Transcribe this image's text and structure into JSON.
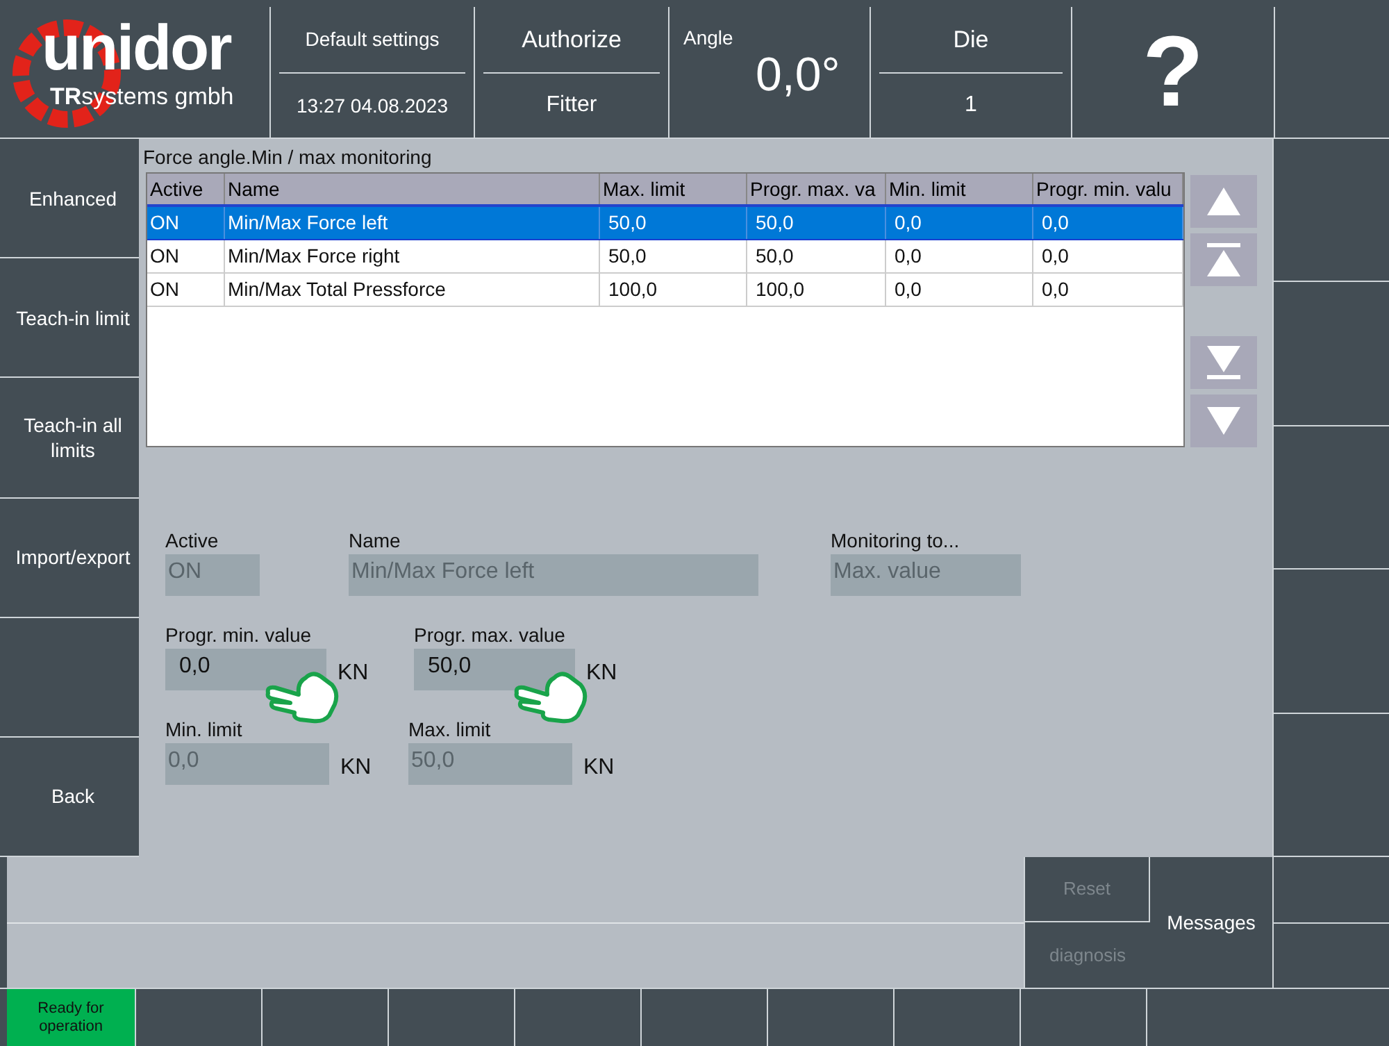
{
  "header": {
    "logo": {
      "brand": "unidor",
      "sub_bold": "TR",
      "sub": "systems gmbh"
    },
    "profile": "Default settings",
    "datetime": "13:27 04.08.2023",
    "authorize_button": "Authorize",
    "user": "Fitter",
    "angle": {
      "label": "Angle",
      "value": "0,0°"
    },
    "die": {
      "label": "Die",
      "value": "1"
    },
    "help_button": "?"
  },
  "sidebar": {
    "items": [
      {
        "label": "Enhanced"
      },
      {
        "label": "Teach-in limit"
      },
      {
        "label": "Teach-in all limits"
      },
      {
        "label": "Import/export"
      },
      {
        "label": "Back"
      }
    ]
  },
  "table": {
    "title": "Force angle.Min / max monitoring",
    "columns": [
      "Active",
      "Name",
      "Max. limit",
      "Progr. max. va",
      "Min. limit",
      "Progr. min. valu"
    ],
    "rows": [
      {
        "selected": true,
        "cells": [
          "ON",
          "Min/Max Force left",
          "50,0",
          "50,0",
          "0,0",
          "0,0"
        ]
      },
      {
        "selected": false,
        "cells": [
          "ON",
          "Min/Max Force right",
          "50,0",
          "50,0",
          "0,0",
          "0,0"
        ]
      },
      {
        "selected": false,
        "cells": [
          "ON",
          "Min/Max Total Pressforce",
          "100,0",
          "100,0",
          "0,0",
          "0,0"
        ]
      }
    ]
  },
  "scroll_buttons": [
    {
      "kind": "up"
    },
    {
      "kind": "top"
    },
    {
      "kind": "bottom"
    },
    {
      "kind": "down"
    }
  ],
  "form": {
    "rows": [
      [
        {
          "label": "Active",
          "value": "ON",
          "disabled": true
        },
        {
          "label": "Name",
          "value": "Min/Max Force left",
          "disabled": true
        },
        {
          "label": "Monitoring to...",
          "value": "Max. value",
          "disabled": true
        }
      ],
      [
        {
          "label": "Progr. min. value",
          "value": "0,0",
          "disabled": false,
          "unit": "KN",
          "pointer": true
        },
        {
          "label": "Progr. max. value",
          "value": "50,0",
          "disabled": false,
          "unit": "KN",
          "pointer": true
        }
      ],
      [
        {
          "label": "Min. limit",
          "value": "0,0",
          "disabled": true,
          "unit": "KN"
        },
        {
          "label": "Max. limit",
          "value": "50,0",
          "disabled": true,
          "unit": "KN"
        }
      ]
    ]
  },
  "footer": {
    "reset_button": {
      "label": "Reset",
      "disabled": true
    },
    "diagnosis_button": {
      "label": "diagnosis",
      "disabled": true
    },
    "messages_button": "Messages"
  },
  "status": {
    "label": "Ready for operation"
  }
}
